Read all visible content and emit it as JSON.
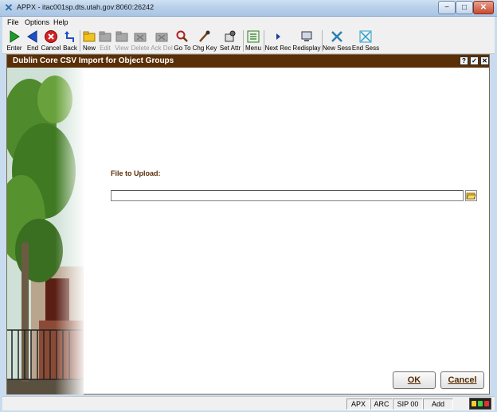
{
  "window": {
    "title": "APPX - itac001sp.dts.utah.gov:8060:26242",
    "minimize_symbol": "−",
    "maximize_symbol": "□",
    "close_symbol": "✕"
  },
  "menu": [
    "File",
    "Options",
    "Help"
  ],
  "toolbar": [
    {
      "label": "Enter",
      "icon": "enter-icon",
      "enabled": true
    },
    {
      "label": "End",
      "icon": "end-icon",
      "enabled": true
    },
    {
      "label": "Cancel",
      "icon": "cancel-icon",
      "enabled": true
    },
    {
      "label": "Back",
      "icon": "back-icon",
      "enabled": true
    },
    {
      "label": "New",
      "icon": "new-folder-icon",
      "enabled": true
    },
    {
      "label": "Edit",
      "icon": "edit-folder-icon",
      "enabled": false
    },
    {
      "label": "View",
      "icon": "view-folder-icon",
      "enabled": false
    },
    {
      "label": "Delete",
      "icon": "delete-folder-icon",
      "enabled": false
    },
    {
      "label": "Ack Del",
      "icon": "ack-delete-icon",
      "enabled": false
    },
    {
      "label": "Go To",
      "icon": "magnifier-icon",
      "enabled": true
    },
    {
      "label": "Chg Key",
      "icon": "change-key-icon",
      "enabled": true
    },
    {
      "label": "Set Attr",
      "icon": "set-attributes-icon",
      "enabled": true
    },
    {
      "label": "Menu",
      "icon": "menu-list-icon",
      "enabled": true
    },
    {
      "label": "Next Rec",
      "icon": "next-record-icon",
      "enabled": true
    },
    {
      "label": "Redisplay",
      "icon": "redisplay-icon",
      "enabled": true
    },
    {
      "label": "New Sess",
      "icon": "new-session-icon",
      "enabled": true
    },
    {
      "label": "End Sess",
      "icon": "end-session-icon",
      "enabled": true
    }
  ],
  "panel": {
    "title": "Dublin Core CSV Import for Object Groups",
    "header_buttons": [
      "?",
      "✓",
      "✕"
    ],
    "file_label": "File to Upload:",
    "file_value": "",
    "ok_label": "OK",
    "cancel_label": "Cancel"
  },
  "status": [
    "APX",
    "ARC",
    "SIP 00",
    "Add"
  ],
  "colors": {
    "header": "#5a2e06",
    "label": "#5a2e06",
    "window_frame": "#c9dcef"
  }
}
